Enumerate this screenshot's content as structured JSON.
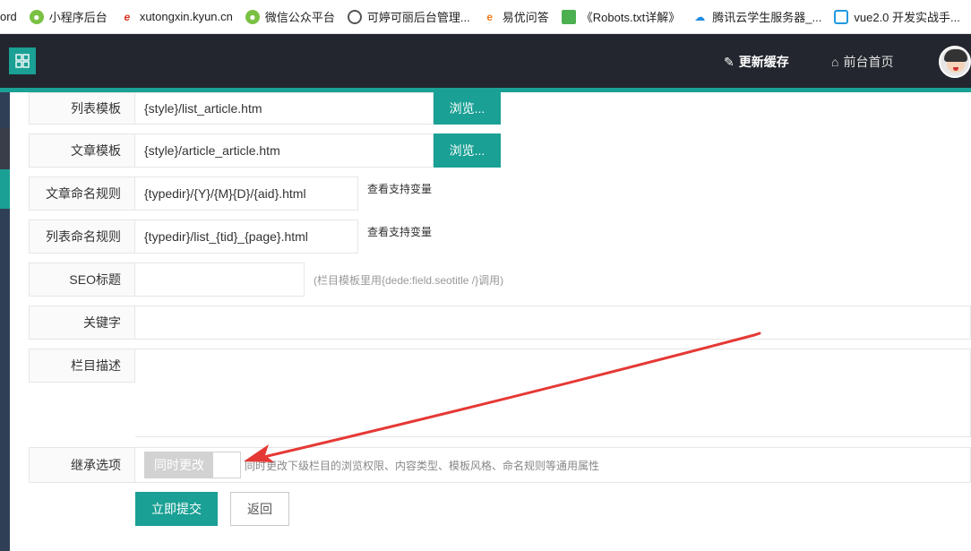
{
  "bookmarks": [
    {
      "label": "ord",
      "icon": ""
    },
    {
      "label": "小程序后台",
      "icon": "wechat-icon"
    },
    {
      "label": "xutongxin.kyun.cn",
      "icon": "e-icon"
    },
    {
      "label": "微信公众平台",
      "icon": "wechat-icon"
    },
    {
      "label": "可婷可丽后台管理...",
      "icon": "globe-icon"
    },
    {
      "label": "易优问答",
      "icon": "e-orange-icon"
    },
    {
      "label": "《Robots.txt详解》",
      "icon": "book-icon"
    },
    {
      "label": "腾讯云学生服务器_...",
      "icon": "cloud-icon"
    },
    {
      "label": "vue2.0 开发实战手...",
      "icon": "tv-icon"
    }
  ],
  "topbar": {
    "menu_toggle_icon": "grid-icon",
    "refresh_cache": "更新缓存",
    "frontend_home": "前台首页"
  },
  "form": {
    "list_template": {
      "label": "列表模板",
      "value": "{style}/list_article.htm",
      "button": "浏览..."
    },
    "article_template": {
      "label": "文章模板",
      "value": "{style}/article_article.htm",
      "button": "浏览..."
    },
    "article_naming": {
      "label": "文章命名规则",
      "value": "{typedir}/{Y}/{M}{D}/{aid}.html",
      "help": "查看支持变量"
    },
    "list_naming": {
      "label": "列表命名规则",
      "value": "{typedir}/list_{tid}_{page}.html",
      "help": "查看支持变量"
    },
    "seo_title": {
      "label": "SEO标题",
      "value": "",
      "hint": "(栏目模板里用{dede:field.seotitle /}调用)"
    },
    "keywords": {
      "label": "关键字",
      "value": ""
    },
    "description": {
      "label": "栏目描述",
      "value": ""
    },
    "inherit": {
      "label": "继承选项",
      "switch_label": "同时更改",
      "hint": "同时更改下级栏目的浏览权限、内容类型、模板风格、命名规则等通用属性"
    }
  },
  "actions": {
    "submit": "立即提交",
    "back": "返回"
  },
  "colors": {
    "accent": "#1aa094",
    "topbar": "#23262e",
    "annotation_arrow": "#e53935"
  }
}
